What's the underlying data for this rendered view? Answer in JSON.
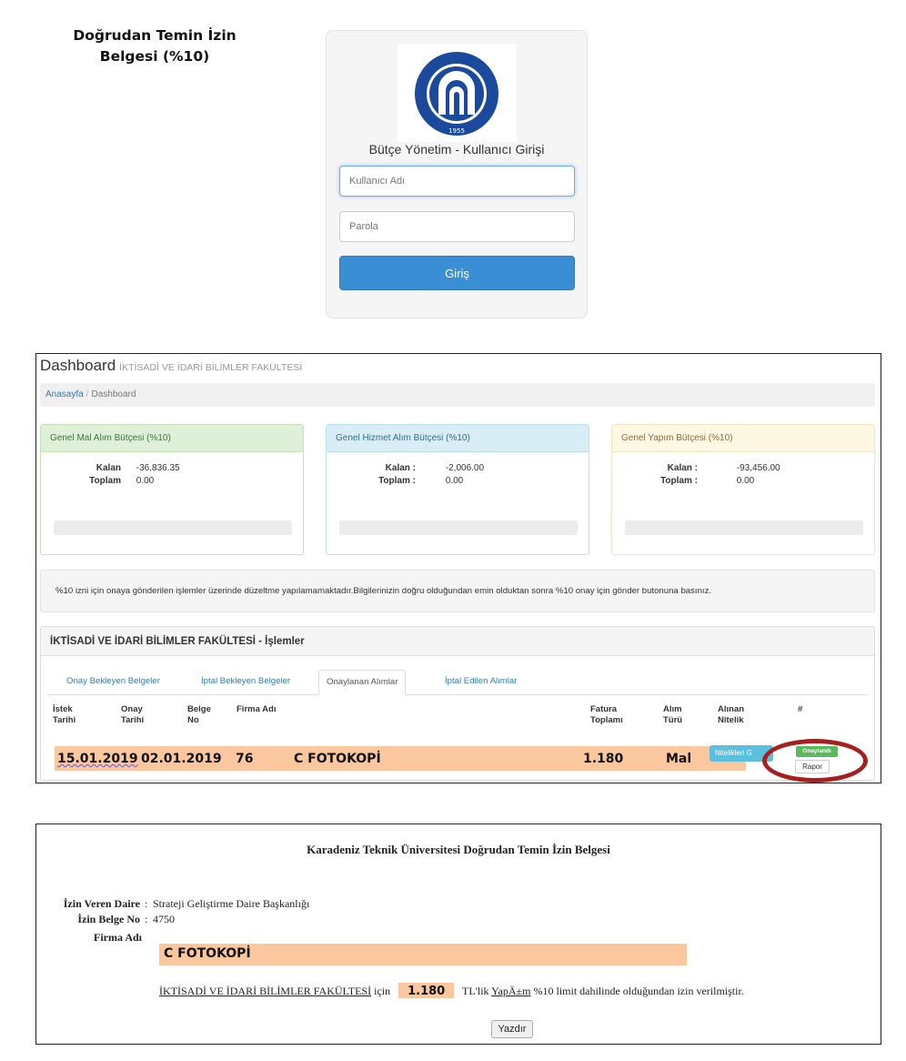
{
  "caption": {
    "line1": "Doğrudan Temin İzin",
    "line2": "Belgesi (%10)"
  },
  "login": {
    "heading": "Bütçe Yönetim - Kullanıcı Girişi",
    "username_placeholder": "Kullanıcı Adı",
    "password_placeholder": "Parola",
    "submit_label": "Giriş",
    "logo_text": "KARADENİZ TEKNİK ÜNİVERSİTESİ",
    "logo_year": "1955"
  },
  "dashboard": {
    "title": "Dashboard",
    "subtitle": "İKTİSADİ VE İDARİ BİLİMLER FAKÜLTESİ",
    "breadcrumb": {
      "home": "Anasayfa",
      "separator": "/",
      "current": "Dashboard"
    },
    "panels": [
      {
        "title": "Genel Mal Alım Bütçesi (%10)",
        "kalan_label": "Kalan",
        "kalan": "-36,836.35",
        "toplam_label": "Toplam",
        "toplam": "0.00"
      },
      {
        "title": "Genel Hizmet Alım Bütçesi (%10)",
        "kalan_label": "Kalan :",
        "kalan": "-2,006.00",
        "toplam_label": "Toplam :",
        "toplam": "0.00"
      },
      {
        "title": "Genel Yapım Bütçesi (%10)",
        "kalan_label": "Kalan :",
        "kalan": "-93,456.00",
        "toplam_label": "Toplam :",
        "toplam": "0.00"
      }
    ],
    "notice": "%10 izni için onaya gönderilen işlemler üzerinde düzeltme yapılamamaktadır.Bilgilerinizin doğru olduğundan emin olduktan sonra %10 onay için gönder butonuna basınız.",
    "ops_title": "İKTİSADİ VE İDARİ BİLİMLER FAKÜLTESİ - İşlemler",
    "tabs": [
      "Onay Bekleyen Belgeler",
      "İptal Bekleyen Belgeler",
      "Onaylanan Alımlar",
      "İptal Edilen Alımlar"
    ],
    "columns": {
      "istek": [
        "İstek",
        "Tarihi"
      ],
      "onay": [
        "Onay",
        "Tarihi"
      ],
      "belge": [
        "Belge",
        "No"
      ],
      "firma": "Firma Adı",
      "fatura": [
        "Fatura",
        "Toplamı"
      ],
      "alim": [
        "Alım",
        "Türü"
      ],
      "nitelik": [
        "Alınan",
        "Nitelik"
      ],
      "hash": "#"
    },
    "row": {
      "istek_tarihi": "15.01.2019",
      "onay_tarihi": "02.01.2019",
      "belge_no": "76",
      "firma": "C FOTOKOPİ",
      "fatura": "1.180",
      "alim_turu": "Mal",
      "nitelik_button": "Nitelikleri G",
      "status_badge": "Onaylandı",
      "rapor_button": "Rapor"
    },
    "colors": {
      "highlight": "#fbc79e",
      "circle": "#a81f1f"
    }
  },
  "permit": {
    "title": "Karadeniz Teknik Üniversitesi Doğrudan Temin İzin Belgesi",
    "izin_veren_label": "İzin Veren Daire",
    "izin_veren_sep": ":",
    "izin_veren": "Strateji Geliştirme Daire Başkanlığı",
    "belge_no_label": "İzin Belge No",
    "belge_no_sep": ":",
    "belge_no": "4750",
    "firma_label": "Firma Adı",
    "firma": "C FOTOKOPİ",
    "faculty": "İKTİSADİ VE İDARİ BİLİMLER FAKÜLTESİ",
    "icin": "için",
    "amount": "1.180",
    "tl_text": "TL'lik",
    "type_text": "YapÄ±m",
    "suffix": "%10 limit dahilinde olduğundan izin verilmiştir.",
    "print_label": "Yazdır"
  }
}
